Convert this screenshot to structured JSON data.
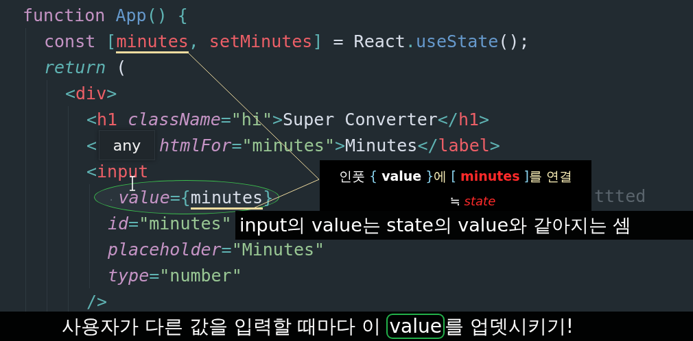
{
  "code_lines": [
    {
      "tokens": [
        {
          "kind": "keyword",
          "text": "function"
        },
        {
          "kind": "function",
          "text": " App"
        },
        {
          "kind": "punct",
          "text": "() {"
        }
      ],
      "children": [
        {
          "tokens": [
            {
              "kind": "keyword",
              "text": "const"
            },
            {
              "kind": "punct",
              "text": " ["
            },
            {
              "kind": "variable",
              "text": "minutes",
              "underlined": true
            },
            {
              "kind": "punct",
              "text": ","
            },
            {
              "kind": "variable",
              "text": " setMinutes"
            },
            {
              "kind": "punct",
              "text": "]"
            },
            {
              "kind": "plain",
              "text": " = React"
            },
            {
              "kind": "punct",
              "text": "."
            },
            {
              "kind": "function",
              "text": "useState"
            },
            {
              "kind": "plain",
              "text": "();"
            }
          ]
        },
        {
          "tokens": [
            {
              "kind": "keyword-italic",
              "text": "return"
            },
            {
              "kind": "plain",
              "text": " ("
            }
          ],
          "children": [
            {
              "tokens": [
                {
                  "kind": "punct",
                  "text": "<"
                },
                {
                  "kind": "tag",
                  "text": "div"
                },
                {
                  "kind": "punct",
                  "text": ">"
                }
              ],
              "children": [
                {
                  "tokens": [
                    {
                      "kind": "punct",
                      "text": "<"
                    },
                    {
                      "kind": "tag",
                      "text": "h1"
                    },
                    {
                      "kind": "attr",
                      "text": " className"
                    },
                    {
                      "kind": "punct",
                      "text": "="
                    },
                    {
                      "kind": "string",
                      "text": "\"hi\""
                    },
                    {
                      "kind": "punct",
                      "text": ">"
                    },
                    {
                      "kind": "plain",
                      "text": "Super Converter"
                    },
                    {
                      "kind": "punct",
                      "text": "</"
                    },
                    {
                      "kind": "tag",
                      "text": "h1"
                    },
                    {
                      "kind": "punct",
                      "text": ">"
                    }
                  ]
                },
                {
                  "tokens": [
                    {
                      "kind": "punct",
                      "text": "<"
                    },
                    {
                      "kind": "tooltip",
                      "text": "any"
                    },
                    {
                      "kind": "attr",
                      "text": "htmlFor"
                    },
                    {
                      "kind": "punct",
                      "text": "="
                    },
                    {
                      "kind": "string",
                      "text": "\"minutes\""
                    },
                    {
                      "kind": "punct",
                      "text": ">"
                    },
                    {
                      "kind": "plain",
                      "text": "Minutes"
                    },
                    {
                      "kind": "punct",
                      "text": "</"
                    },
                    {
                      "kind": "tag",
                      "text": "label"
                    },
                    {
                      "kind": "punct",
                      "text": ">"
                    }
                  ]
                },
                {
                  "tokens": [
                    {
                      "kind": "punct",
                      "text": "<"
                    },
                    {
                      "kind": "tag",
                      "text": "input"
                    }
                  ],
                  "children": [
                    {
                      "highlighted": true,
                      "tokens": [
                        {
                          "kind": "whitespace",
                          "text": "·"
                        },
                        {
                          "kind": "attr",
                          "text": "value"
                        },
                        {
                          "kind": "punct",
                          "text": "={"
                        },
                        {
                          "kind": "plain",
                          "text": "minutes",
                          "underlined": true
                        },
                        {
                          "kind": "punct",
                          "text": "}"
                        }
                      ]
                    },
                    {
                      "tokens": [
                        {
                          "kind": "attr",
                          "text": "id"
                        },
                        {
                          "kind": "punct",
                          "text": "="
                        },
                        {
                          "kind": "string",
                          "text": "\"minutes\""
                        }
                      ]
                    },
                    {
                      "tokens": [
                        {
                          "kind": "attr",
                          "text": "placeholder"
                        },
                        {
                          "kind": "punct",
                          "text": "="
                        },
                        {
                          "kind": "string",
                          "text": "\"Minutes\""
                        }
                      ]
                    },
                    {
                      "tokens": [
                        {
                          "kind": "attr",
                          "text": "type"
                        },
                        {
                          "kind": "punct",
                          "text": "="
                        },
                        {
                          "kind": "string",
                          "text": "\"number\""
                        }
                      ]
                    }
                  ]
                },
                {
                  "tokens": [
                    {
                      "kind": "punct",
                      "text": "/>"
                    }
                  ]
                }
              ]
            }
          ]
        }
      ]
    }
  ],
  "faded_fragment": "ttted",
  "annotation": {
    "line_1": [
      {
        "kind": "plain",
        "text": "인풋 "
      },
      {
        "kind": "bracket",
        "text": "{ "
      },
      {
        "kind": "bold",
        "text": "value"
      },
      {
        "kind": "bracket",
        "text": " }"
      },
      {
        "kind": "warm",
        "text": "에 "
      },
      {
        "kind": "bracket",
        "text": "[ "
      },
      {
        "kind": "bold-red",
        "text": "minutes"
      },
      {
        "kind": "bracket",
        "text": " ]"
      },
      {
        "kind": "warm",
        "text": "를 연결"
      }
    ],
    "line_2": [
      {
        "kind": "plain",
        "text": "≒ "
      },
      {
        "kind": "italic-red",
        "text": "state"
      }
    ]
  },
  "subtitle_top": "input의 value는 state의 value와 같아지는 셈",
  "subtitle_bottom": {
    "before": "사용자가 다른 값을 입력할 때마다 이 ",
    "boxed": "value",
    "after": "를 업뎃시키기!"
  }
}
